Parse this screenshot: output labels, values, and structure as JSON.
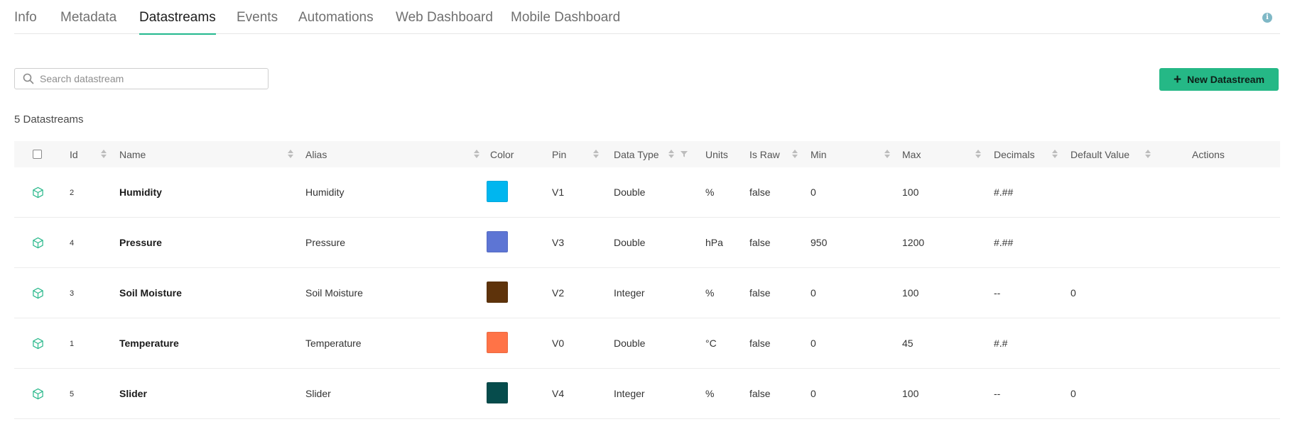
{
  "tabs": [
    {
      "label": "Info",
      "active": false
    },
    {
      "label": "Metadata",
      "active": false
    },
    {
      "label": "Datastreams",
      "active": true
    },
    {
      "label": "Events",
      "active": false
    },
    {
      "label": "Automations",
      "active": false
    },
    {
      "label": "Web Dashboard",
      "active": false
    },
    {
      "label": "Mobile Dashboard",
      "active": false
    }
  ],
  "info_icon": "info-icon",
  "search": {
    "placeholder": "Search datastream",
    "value": "",
    "icon": "search-icon"
  },
  "new_button": {
    "label": "New Datastream",
    "icon": "plus-icon"
  },
  "count_label": "5 Datastreams",
  "accent_color": "#25b886",
  "columns": [
    "Id",
    "Name",
    "Alias",
    "Color",
    "Pin",
    "Data Type",
    "Units",
    "Is Raw",
    "Min",
    "Max",
    "Decimals",
    "Default Value",
    "Actions"
  ],
  "rows": [
    {
      "icon": "cube-icon",
      "id": "2",
      "name": "Humidity",
      "alias": "Humidity",
      "color": "#00b6ef",
      "pin": "V1",
      "data_type": "Double",
      "units": "%",
      "is_raw": "false",
      "min": "0",
      "max": "100",
      "decimals": "#.##",
      "default_value": ""
    },
    {
      "icon": "cube-icon",
      "id": "4",
      "name": "Pressure",
      "alias": "Pressure",
      "color": "#5d75d4",
      "pin": "V3",
      "data_type": "Double",
      "units": "hPa",
      "is_raw": "false",
      "min": "950",
      "max": "1200",
      "decimals": "#.##",
      "default_value": ""
    },
    {
      "icon": "cube-icon",
      "id": "3",
      "name": "Soil Moisture",
      "alias": "Soil Moisture",
      "color": "#5e330b",
      "pin": "V2",
      "data_type": "Integer",
      "units": "%",
      "is_raw": "false",
      "min": "0",
      "max": "100",
      "decimals": "--",
      "default_value": "0"
    },
    {
      "icon": "cube-icon",
      "id": "1",
      "name": "Temperature",
      "alias": "Temperature",
      "color": "#ff7347",
      "pin": "V0",
      "data_type": "Double",
      "units": "°C",
      "is_raw": "false",
      "min": "0",
      "max": "45",
      "decimals": "#.#",
      "default_value": ""
    },
    {
      "icon": "cube-icon",
      "id": "5",
      "name": "Slider",
      "alias": "Slider",
      "color": "#064c4c",
      "pin": "V4",
      "data_type": "Integer",
      "units": "%",
      "is_raw": "false",
      "min": "0",
      "max": "100",
      "decimals": "--",
      "default_value": "0"
    }
  ]
}
